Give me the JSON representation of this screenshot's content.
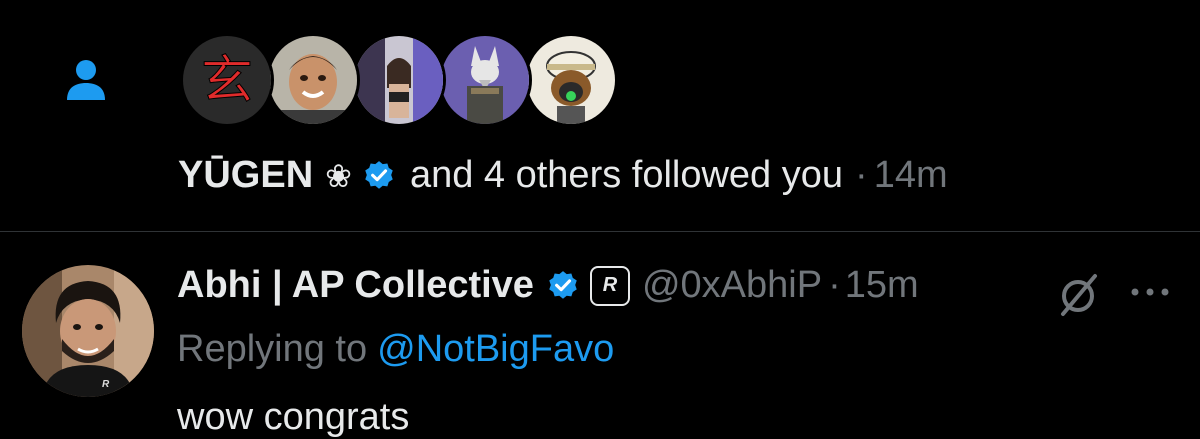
{
  "follow_notification": {
    "icon": "person-icon",
    "avatars": [
      "kanji-avatar",
      "boy-photo-avatar",
      "selfie-avatar",
      "wolf-samurai-avatar",
      "monkey-gasmask-avatar"
    ],
    "name": "YŪGEN",
    "flower_glyph": "❀",
    "text": "and 4 others followed you",
    "separator": "·",
    "time": "14m",
    "kanji": "玄"
  },
  "reply_tweet": {
    "author_name": "Abhi | AP Collective",
    "affiliate_badge": "R",
    "handle": "@0xAbhiP",
    "separator": "·",
    "time": "15m",
    "replying_prefix": "Replying to",
    "replying_to": "@NotBigFavo",
    "text": "wow congrats"
  },
  "colors": {
    "background": "#000000",
    "text": "#e7e9ea",
    "secondary": "#71767b",
    "accent": "#1d9bf0",
    "divider": "#2f3336"
  }
}
